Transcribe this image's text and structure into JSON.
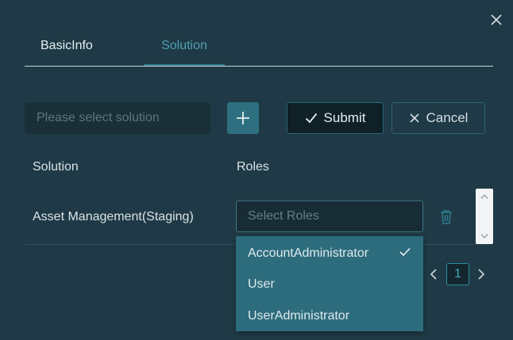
{
  "tabs": [
    {
      "label": "BasicInfo"
    },
    {
      "label": "Solution",
      "active": true
    }
  ],
  "toolbar": {
    "solution_placeholder": "Please select solution",
    "submit_label": "Submit",
    "cancel_label": "Cancel"
  },
  "table": {
    "headers": {
      "solution": "Solution",
      "roles": "Roles"
    },
    "rows": [
      {
        "solution": "Asset Management(Staging)",
        "roles_placeholder": "Select Roles"
      }
    ]
  },
  "roles_dropdown": {
    "options": [
      {
        "label": "AccountAdministrator",
        "selected": true
      },
      {
        "label": "User",
        "selected": false
      },
      {
        "label": "UserAdministrator",
        "selected": false
      }
    ]
  },
  "pagination": {
    "current_page": "1"
  },
  "colors": {
    "background": "#1f3a46",
    "accent": "#2e7080",
    "active_tab": "#4f9fb1",
    "dropdown": "#2d6c7d"
  },
  "icons": [
    "close-icon",
    "plus-icon",
    "check-icon",
    "x-icon",
    "trash-icon",
    "chevron-left-icon",
    "chevron-right-icon",
    "scroll-up-icon",
    "scroll-down-icon"
  ]
}
